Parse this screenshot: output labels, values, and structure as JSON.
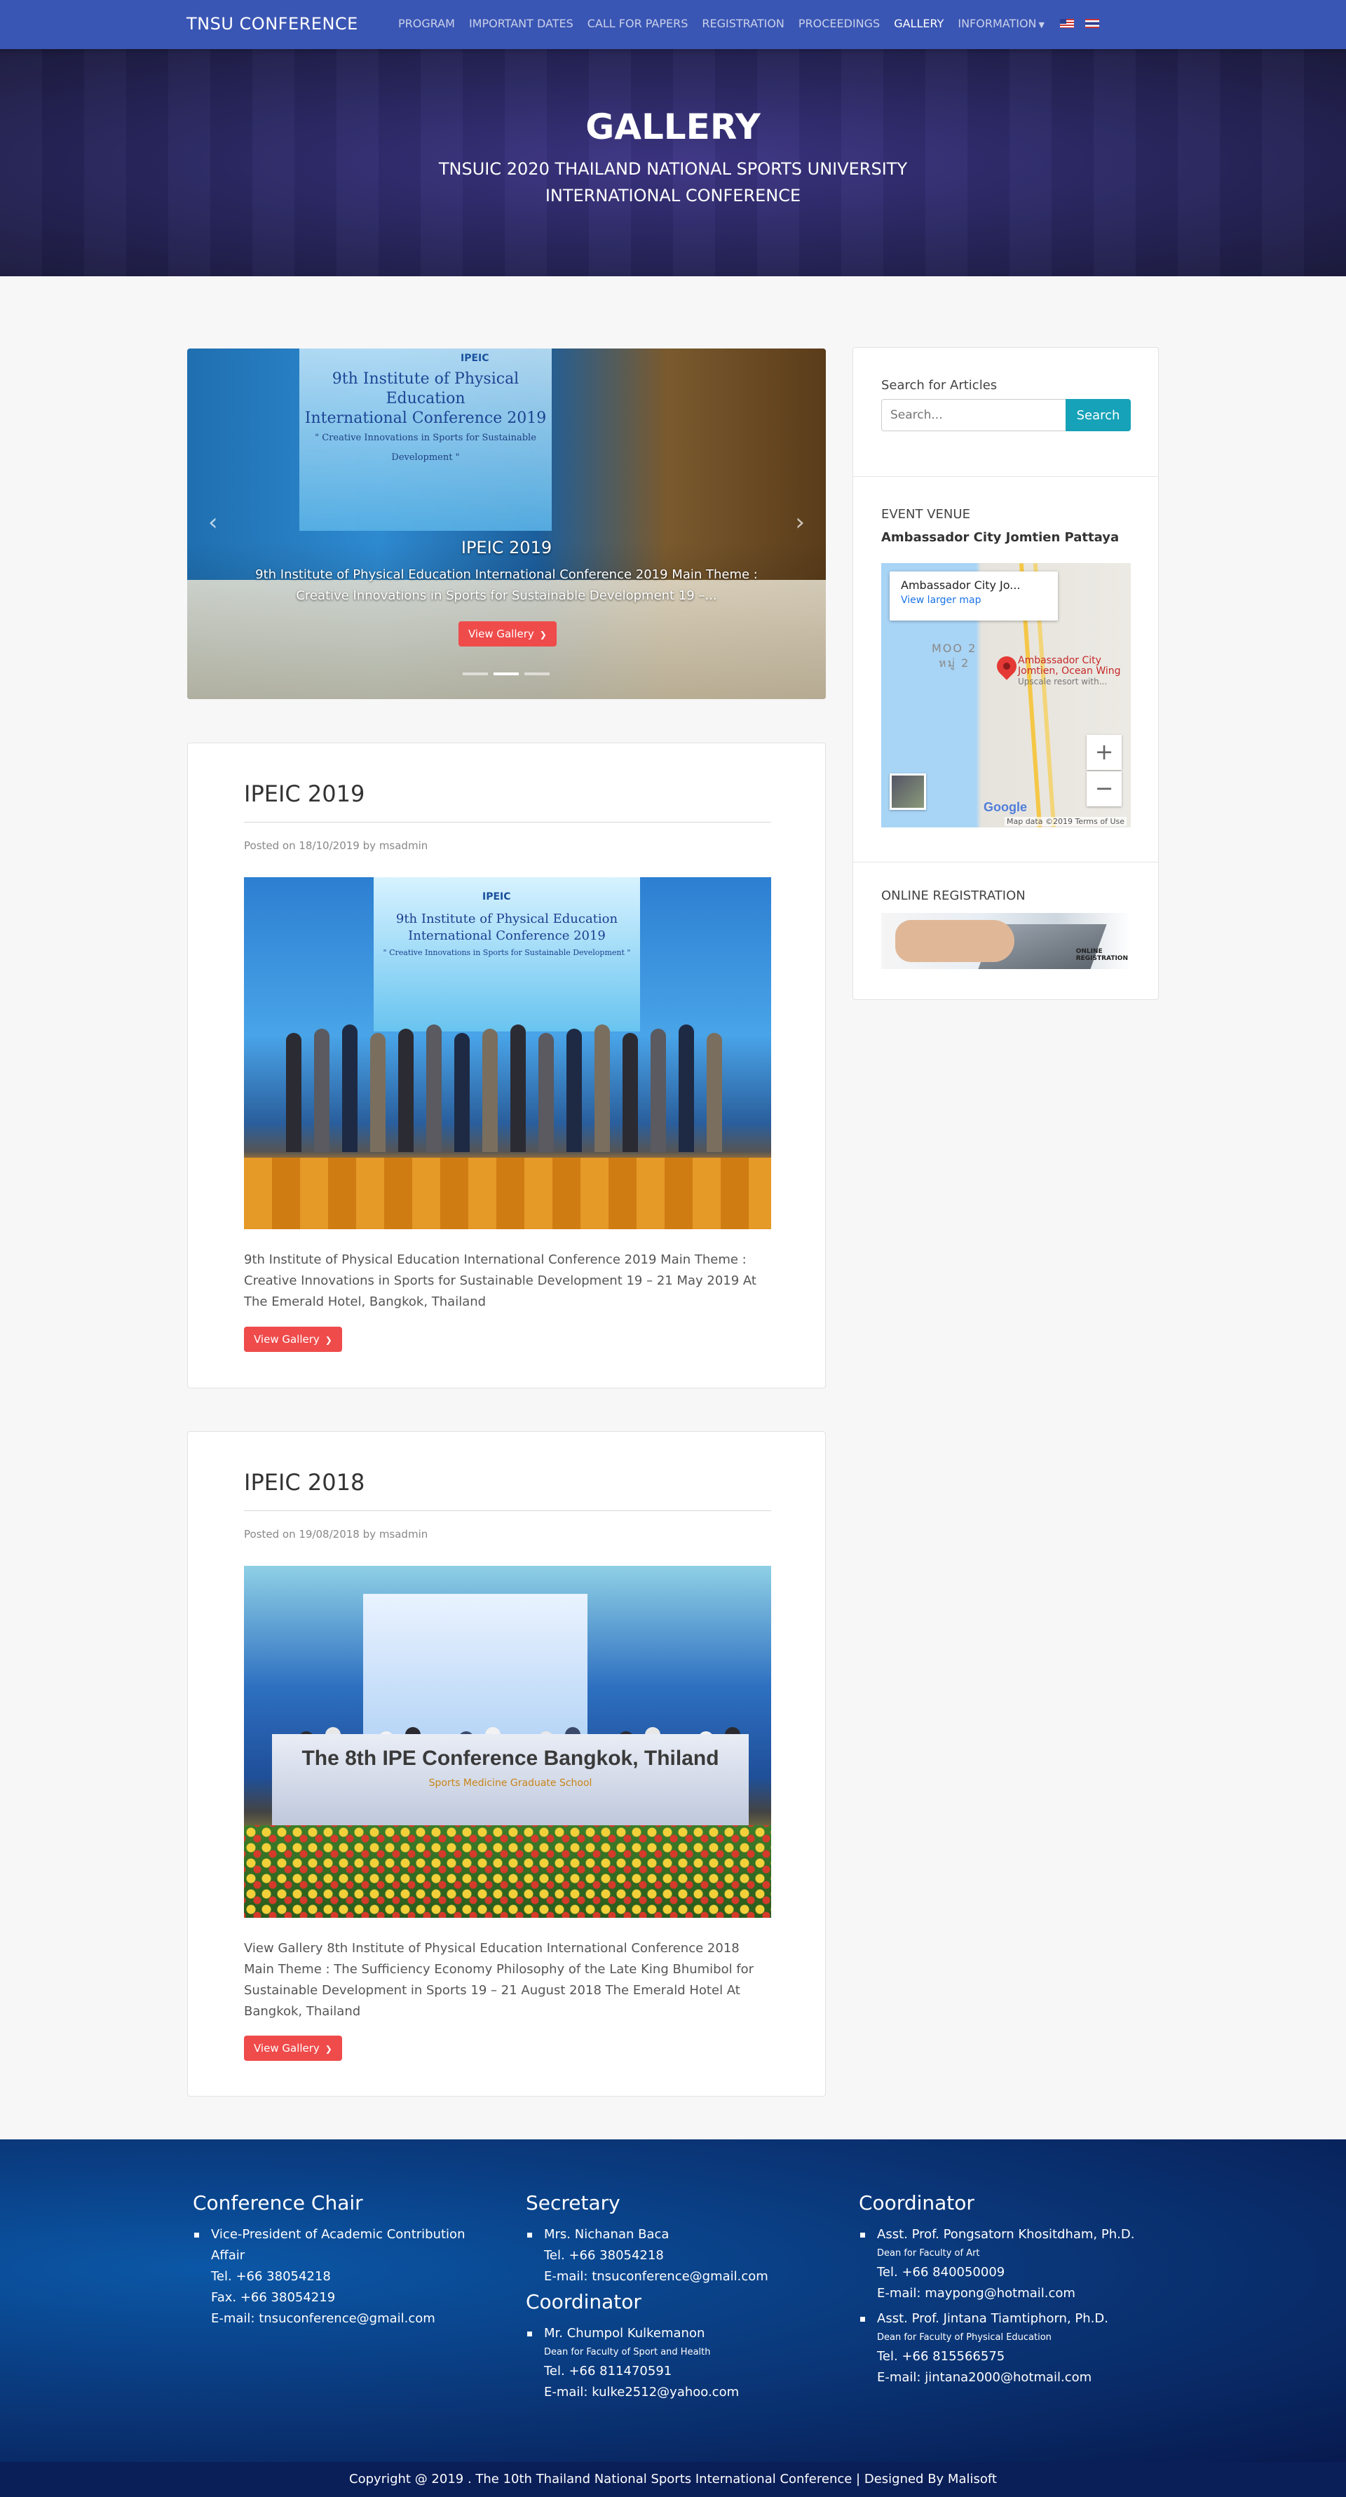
{
  "navbar": {
    "brand": "TNSU CONFERENCE",
    "items": [
      {
        "label": "PROGRAM"
      },
      {
        "label": "IMPORTANT DATES"
      },
      {
        "label": "CALL FOR PAPERS"
      },
      {
        "label": "REGISTRATION"
      },
      {
        "label": "PROCEEDINGS"
      },
      {
        "label": "GALLERY",
        "active": true
      },
      {
        "label": "INFORMATION"
      }
    ],
    "languages": [
      "us-flag-icon",
      "th-flag-icon"
    ]
  },
  "hero": {
    "title": "GALLERY",
    "subtitle_line1": "TNSUIC 2020 THAILAND NATIONAL SPORTS UNIVERSITY",
    "subtitle_line2": "INTERNATIONAL CONFERENCE"
  },
  "carousel": {
    "title": "IPEIC 2019",
    "text_line1": "9th Institute of Physical Education International Conference 2019 Main Theme :",
    "text_line2": "Creative Innovations in Sports for Sustainable Development 19 –...",
    "button": "View Gallery",
    "slides": 3,
    "active_slide": 2,
    "photo_text": {
      "ipeic_badge": "IPEIC",
      "line1": "9th Institute of Physical Education",
      "line2": "International Conference 2019",
      "line3": "\" Creative Innovations in Sports for Sustainable Development \""
    }
  },
  "posts": [
    {
      "title": "IPEIC 2019",
      "meta_prefix": "Posted on",
      "date": "18/10/2019",
      "meta_by": "by",
      "author": "msadmin",
      "text": "9th Institute of Physical Education International Conference 2019 Main Theme : Creative Innovations in Sports for Sustainable Development 19 – 21 May 2019 At The Emerald Hotel, Bangkok, Thailand",
      "button": "View Gallery",
      "photo_text": {
        "ipeic_badge": "IPEIC",
        "line1": "9th Institute of Physical Education",
        "line2": "International Conference 2019",
        "line3": "\" Creative Innovations in Sports for Sustainable Development \""
      }
    },
    {
      "title": "IPEIC 2018",
      "meta_prefix": "Posted on",
      "date": "19/08/2018",
      "meta_by": "by",
      "author": "msadmin",
      "text": "View Gallery 8th Institute of Physical Education International Conference 2018 Main Theme : The Sufficiency Economy Philosophy of the Late King Bhumibol for Sustainable Development in Sports 19 – 21 August 2018 The Emerald Hotel At Bangkok, Thailand",
      "button": "View Gallery",
      "banner_text": "The 8th IPE Conference Bangkok, Thiland",
      "banner_sub": "Sports Medicine Graduate School"
    }
  ],
  "sidebar": {
    "search_label": "Search for Articles",
    "search_placeholder": "Search...",
    "search_button": "Search",
    "venue_heading": "EVENT VENUE",
    "venue_name": "Ambassador City Jomtien Pattaya",
    "map": {
      "card_title": "Ambassador City Jo...",
      "card_link": "View larger map",
      "pin_label_line1": "Ambassador City",
      "pin_label_line2": "Jomtien, Ocean Wing",
      "pin_label_line3": "Upscale resort with...",
      "area_label_line1": "MOO 2",
      "area_label_line2": "หมู่ 2",
      "zoom_in": "+",
      "zoom_out": "−",
      "brand": "Google",
      "footer": "Map data ©2019   Terms of Use"
    },
    "registration_heading": "ONLINE REGISTRATION",
    "registration_image_line1": "ONLINE",
    "registration_image_line2": "REGISTRATION"
  },
  "footer": {
    "chair": {
      "heading": "Conference Chair",
      "line1": "Vice-President of Academic Contribution",
      "line2": "Affair",
      "tel": "Tel. +66 38054218",
      "fax": "Fax. +66 38054219",
      "email": "E-mail: tnsuconference@gmail.com"
    },
    "secretary": {
      "heading": "Secretary",
      "name": "Mrs. Nichanan Baca",
      "tel": "Tel. +66 38054218",
      "email": "E-mail: tnsuconference@gmail.com"
    },
    "coordinator_mid": {
      "heading": "Coordinator",
      "name": "Mr. Chumpol Kulkemanon",
      "role": "Dean for Faculty of Sport and Health",
      "tel": "Tel. +66 811470591",
      "email": "E-mail: kulke2512@yahoo.com"
    },
    "coordinator_right": {
      "heading": "Coordinator",
      "p1_name": "Asst. Prof. Pongsatorn Khositdham, Ph.D.",
      "p1_role": "Dean for Faculty of Art",
      "p1_tel": "Tel. +66 840050009",
      "p1_email": "E-mail: maypong@hotmail.com",
      "p2_name": "Asst. Prof. Jintana Tiamtiphorn, Ph.D.",
      "p2_role": "Dean for Faculty of Physical Education",
      "p2_tel": "Tel. +66 815566575",
      "p2_email": "E-mail: jintana2000@hotmail.com"
    },
    "copyright": "Copyright @ 2019 . The 10th Thailand National Sports International Conference | Designed By Malisoft"
  },
  "colors": {
    "navbar": "#3a56b4",
    "accent_red": "#ef4b4b",
    "search_teal": "#16a2b8",
    "footer_dark": "#081a4f"
  }
}
